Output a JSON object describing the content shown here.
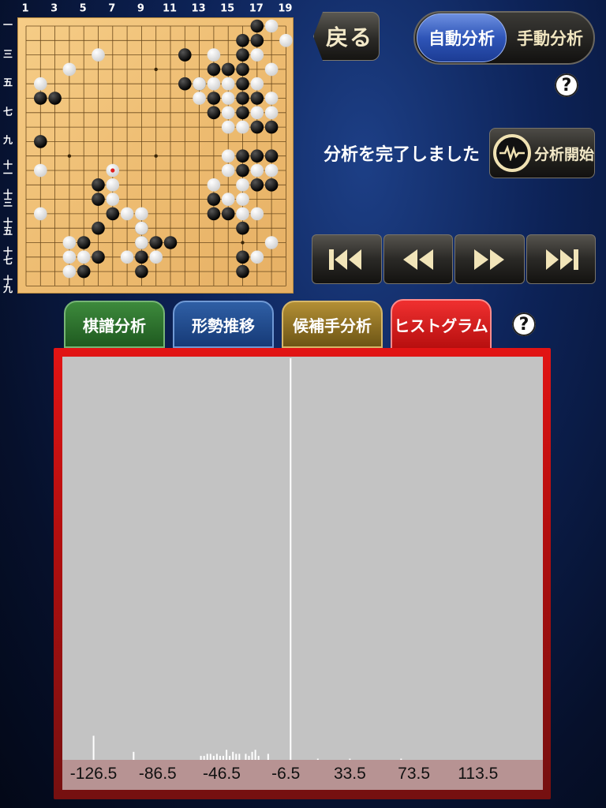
{
  "board": {
    "col_labels": [
      "1",
      "3",
      "5",
      "7",
      "9",
      "11",
      "13",
      "15",
      "17",
      "19"
    ],
    "row_labels": [
      "一",
      "三",
      "五",
      "七",
      "九",
      "十一",
      "十三",
      "十五",
      "十七",
      "十九"
    ],
    "stones_black": [
      [
        17,
        1
      ],
      [
        16,
        2
      ],
      [
        17,
        2
      ],
      [
        12,
        3
      ],
      [
        16,
        3
      ],
      [
        14,
        4
      ],
      [
        15,
        4
      ],
      [
        16,
        4
      ],
      [
        12,
        5
      ],
      [
        13,
        5
      ],
      [
        16,
        5
      ],
      [
        2,
        6
      ],
      [
        3,
        6
      ],
      [
        14,
        6
      ],
      [
        16,
        6
      ],
      [
        17,
        6
      ],
      [
        14,
        7
      ],
      [
        16,
        7
      ],
      [
        17,
        8
      ],
      [
        18,
        8
      ],
      [
        2,
        9
      ],
      [
        16,
        10
      ],
      [
        17,
        10
      ],
      [
        18,
        10
      ],
      [
        16,
        11
      ],
      [
        6,
        12
      ],
      [
        17,
        12
      ],
      [
        18,
        12
      ],
      [
        6,
        13
      ],
      [
        14,
        13
      ],
      [
        15,
        14
      ],
      [
        7,
        14
      ],
      [
        14,
        14
      ],
      [
        16,
        15
      ],
      [
        9,
        15
      ],
      [
        6,
        15
      ],
      [
        5,
        16
      ],
      [
        10,
        16
      ],
      [
        11,
        16
      ],
      [
        9,
        16
      ],
      [
        6,
        17
      ],
      [
        9,
        17
      ],
      [
        16,
        17
      ],
      [
        5,
        18
      ],
      [
        9,
        18
      ],
      [
        16,
        18
      ]
    ],
    "stones_white": [
      [
        18,
        1
      ],
      [
        19,
        2
      ],
      [
        6,
        3
      ],
      [
        14,
        3
      ],
      [
        17,
        3
      ],
      [
        4,
        4
      ],
      [
        18,
        4
      ],
      [
        2,
        5
      ],
      [
        13,
        5
      ],
      [
        14,
        5
      ],
      [
        15,
        5
      ],
      [
        17,
        5
      ],
      [
        13,
        6
      ],
      [
        15,
        6
      ],
      [
        18,
        6
      ],
      [
        15,
        7
      ],
      [
        17,
        7
      ],
      [
        18,
        7
      ],
      [
        15,
        8
      ],
      [
        16,
        8
      ],
      [
        15,
        10
      ],
      [
        15,
        11
      ],
      [
        17,
        11
      ],
      [
        18,
        11
      ],
      [
        2,
        11
      ],
      [
        7,
        11
      ],
      [
        7,
        12
      ],
      [
        14,
        12
      ],
      [
        16,
        12
      ],
      [
        7,
        13
      ],
      [
        15,
        13
      ],
      [
        16,
        13
      ],
      [
        2,
        14
      ],
      [
        8,
        14
      ],
      [
        9,
        14
      ],
      [
        16,
        14
      ],
      [
        17,
        14
      ],
      [
        9,
        15
      ],
      [
        4,
        16
      ],
      [
        9,
        16
      ],
      [
        18,
        16
      ],
      [
        4,
        17
      ],
      [
        5,
        17
      ],
      [
        8,
        17
      ],
      [
        10,
        17
      ],
      [
        17,
        17
      ],
      [
        4,
        18
      ]
    ],
    "last_move": [
      7,
      11
    ]
  },
  "header": {
    "back_label": "戻る",
    "mode_auto": "自動分析",
    "mode_manual": "手動分析",
    "help": "?"
  },
  "status": {
    "text": "分析を完了しました",
    "start_label": "分析開始"
  },
  "tabs": {
    "kifu": "棋譜分析",
    "keisei": "形勢推移",
    "kouho": "候補手分析",
    "histogram": "ヒストグラム"
  },
  "chart_data": {
    "type": "bar",
    "xlabel": "",
    "ylabel": "",
    "tick_labels": [
      "-126.5",
      "-86.5",
      "-46.5",
      "-6.5",
      "33.5",
      "73.5",
      "113.5"
    ],
    "tick_values": [
      -126.5,
      -86.5,
      -46.5,
      -6.5,
      33.5,
      73.5,
      113.5
    ],
    "x_range": [
      -146,
      154
    ],
    "bins": [
      {
        "x": -126.5,
        "count": 6
      },
      {
        "x": -101.5,
        "count": 2
      },
      {
        "x": -59.5,
        "count": 1
      },
      {
        "x": -57.5,
        "count": 1
      },
      {
        "x": -55.5,
        "count": 1.5
      },
      {
        "x": -53.5,
        "count": 1.5
      },
      {
        "x": -51.5,
        "count": 1
      },
      {
        "x": -49.5,
        "count": 1.5
      },
      {
        "x": -47.5,
        "count": 1
      },
      {
        "x": -45.5,
        "count": 1
      },
      {
        "x": -43.5,
        "count": 2.5
      },
      {
        "x": -41.5,
        "count": 1
      },
      {
        "x": -39.5,
        "count": 2
      },
      {
        "x": -37.5,
        "count": 1.5
      },
      {
        "x": -35.5,
        "count": 1.5
      },
      {
        "x": -31.5,
        "count": 1.5
      },
      {
        "x": -29.5,
        "count": 1
      },
      {
        "x": -27.5,
        "count": 2
      },
      {
        "x": -25.5,
        "count": 2.5
      },
      {
        "x": -23.5,
        "count": 1
      },
      {
        "x": -17.5,
        "count": 1.5
      },
      {
        "x": -3.5,
        "count": 100
      },
      {
        "x": 13.5,
        "count": 0.3
      },
      {
        "x": 33.5,
        "count": 0.3
      },
      {
        "x": 65.5,
        "count": 0.3
      }
    ],
    "y_max": 100,
    "bar_color": "#ffffff",
    "plot_bg": "#c3c3c3"
  }
}
